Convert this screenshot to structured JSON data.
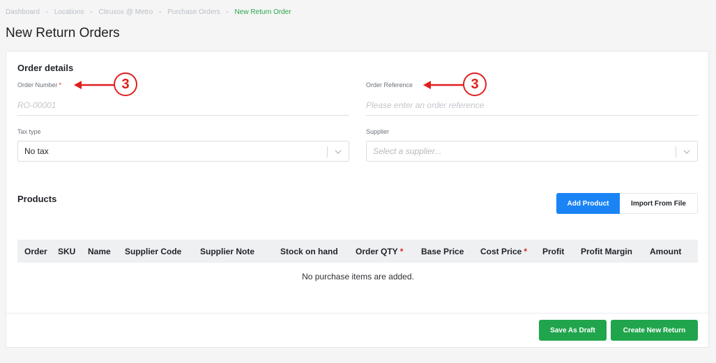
{
  "breadcrumb": {
    "items": [
      "Dashboard",
      "Locations",
      "Citrusox @ Metro",
      "Purchase Orders"
    ],
    "active": "New Return Order",
    "separator": "•"
  },
  "page": {
    "title": "New Return Orders"
  },
  "order_details": {
    "title": "Order details",
    "order_number": {
      "label": "Order Number",
      "required_mark": "*",
      "value": "",
      "placeholder": "RO-00001"
    },
    "order_reference": {
      "label": "Order Reference",
      "value": "",
      "placeholder": "Please enter an order reference"
    },
    "tax_type": {
      "label": "Tax type",
      "value": "No tax"
    },
    "supplier": {
      "label": "Supplier",
      "placeholder": "Select a supplier..."
    }
  },
  "products": {
    "title": "Products",
    "add_product_label": "Add Product",
    "import_label": "Import From File",
    "columns": [
      {
        "label": "Order",
        "required": ""
      },
      {
        "label": "SKU",
        "required": ""
      },
      {
        "label": "Name",
        "required": ""
      },
      {
        "label": "Supplier Code",
        "required": ""
      },
      {
        "label": "Supplier Note",
        "required": ""
      },
      {
        "label": "Stock on hand",
        "required": ""
      },
      {
        "label": "Order QTY",
        "required": "*"
      },
      {
        "label": "Base Price",
        "required": ""
      },
      {
        "label": "Cost Price",
        "required": "*"
      },
      {
        "label": "Profit",
        "required": ""
      },
      {
        "label": "Profit Margin",
        "required": ""
      },
      {
        "label": "Amount",
        "required": ""
      }
    ],
    "empty_message": "No purchase items are added."
  },
  "footer": {
    "save_draft_label": "Save As Draft",
    "create_label": "Create New Return"
  },
  "annotations": [
    {
      "number": "3"
    },
    {
      "number": "3"
    }
  ],
  "colors": {
    "primary_blue": "#1b84f5",
    "success_green": "#20a54c",
    "required_red": "#e02424",
    "annotation_red": "#e01e1e",
    "breadcrumb_active": "#2aa54b"
  }
}
